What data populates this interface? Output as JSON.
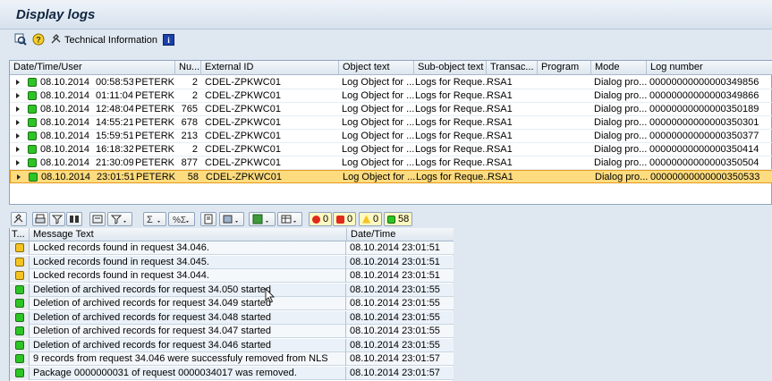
{
  "window": {
    "title": "Display logs"
  },
  "toolbar": {
    "technical_info_label": "Technical Information",
    "icons": [
      "find-icon",
      "help-icon",
      "technical-info-icon",
      "info-icon"
    ]
  },
  "log_table": {
    "columns": [
      "Date/Time/User",
      "Nu...",
      "External ID",
      "Object text",
      "Sub-object text",
      "Transac...",
      "Program",
      "Mode",
      "Log number"
    ],
    "rows": [
      {
        "date": "08.10.2014",
        "time": "00:58:53",
        "user": "PETERK",
        "num": "2",
        "ext": "CDEL-ZPKWC01",
        "obj": "Log Object for ...",
        "sub": "Logs for Reque...",
        "trans": "RSA1",
        "prog": "",
        "mode": "Dialog pro...",
        "log": "00000000000000349856"
      },
      {
        "date": "08.10.2014",
        "time": "01:11:04",
        "user": "PETERK",
        "num": "2",
        "ext": "CDEL-ZPKWC01",
        "obj": "Log Object for ...",
        "sub": "Logs for Reque...",
        "trans": "RSA1",
        "prog": "",
        "mode": "Dialog pro...",
        "log": "00000000000000349866"
      },
      {
        "date": "08.10.2014",
        "time": "12:48:04",
        "user": "PETERK",
        "num": "765",
        "ext": "CDEL-ZPKWC01",
        "obj": "Log Object for ...",
        "sub": "Logs for Reque...",
        "trans": "RSA1",
        "prog": "",
        "mode": "Dialog pro...",
        "log": "00000000000000350189"
      },
      {
        "date": "08.10.2014",
        "time": "14:55:21",
        "user": "PETERK",
        "num": "678",
        "ext": "CDEL-ZPKWC01",
        "obj": "Log Object for ...",
        "sub": "Logs for Reque...",
        "trans": "RSA1",
        "prog": "",
        "mode": "Dialog pro...",
        "log": "00000000000000350301"
      },
      {
        "date": "08.10.2014",
        "time": "15:59:51",
        "user": "PETERK",
        "num": "213",
        "ext": "CDEL-ZPKWC01",
        "obj": "Log Object for ...",
        "sub": "Logs for Reque...",
        "trans": "RSA1",
        "prog": "",
        "mode": "Dialog pro...",
        "log": "00000000000000350377"
      },
      {
        "date": "08.10.2014",
        "time": "16:18:32",
        "user": "PETERK",
        "num": "2",
        "ext": "CDEL-ZPKWC01",
        "obj": "Log Object for ...",
        "sub": "Logs for Reque...",
        "trans": "RSA1",
        "prog": "",
        "mode": "Dialog pro...",
        "log": "00000000000000350414"
      },
      {
        "date": "08.10.2014",
        "time": "21:30:09",
        "user": "PETERK",
        "num": "877",
        "ext": "CDEL-ZPKWC01",
        "obj": "Log Object for ...",
        "sub": "Logs for Reque...",
        "trans": "RSA1",
        "prog": "",
        "mode": "Dialog pro...",
        "log": "00000000000000350504"
      },
      {
        "date": "08.10.2014",
        "time": "23:01:51",
        "user": "PETERK",
        "num": "58",
        "ext": "CDEL-ZPKWC01",
        "obj": "Log Object for ...",
        "sub": "Logs for Reque...",
        "trans": "RSA1",
        "prog": "",
        "mode": "Dialog pro...",
        "log": "00000000000000350533"
      }
    ],
    "selected_row": 7
  },
  "message_toolbar": {
    "counts": {
      "error": "0",
      "stop": "0",
      "warning": "0",
      "success": "58"
    }
  },
  "messages": {
    "columns": [
      "T...",
      "Message Text",
      "Date/Time"
    ],
    "rows": [
      {
        "type": "warning",
        "text": "Locked records found in request 34.046.",
        "dt": "08.10.2014 23:01:51"
      },
      {
        "type": "warning",
        "text": "Locked records found in request 34.045.",
        "dt": "08.10.2014 23:01:51"
      },
      {
        "type": "warning",
        "text": "Locked records found in request 34.044.",
        "dt": "08.10.2014 23:01:51"
      },
      {
        "type": "success",
        "text": "Deletion of archived records for request 34.050 started",
        "dt": "08.10.2014 23:01:55"
      },
      {
        "type": "success",
        "text": "Deletion of archived records for request 34.049 started",
        "dt": "08.10.2014 23:01:55"
      },
      {
        "type": "success",
        "text": "Deletion of archived records for request 34.048 started",
        "dt": "08.10.2014 23:01:55"
      },
      {
        "type": "success",
        "text": "Deletion of archived records for request 34.047 started",
        "dt": "08.10.2014 23:01:55"
      },
      {
        "type": "success",
        "text": "Deletion of archived records for request 34.046 started",
        "dt": "08.10.2014 23:01:55"
      },
      {
        "type": "success",
        "text": "9 records from request 34.046 were successfuly removed from NLS",
        "dt": "08.10.2014 23:01:57"
      },
      {
        "type": "success",
        "text": "Package 0000000031 of request 0000034017 was removed.",
        "dt": "08.10.2014 23:01:57"
      }
    ]
  },
  "colors": {
    "success": "#2dc425",
    "warning": "#f4c321",
    "error": "#e0281c",
    "selected_row": "#fddc7f"
  }
}
